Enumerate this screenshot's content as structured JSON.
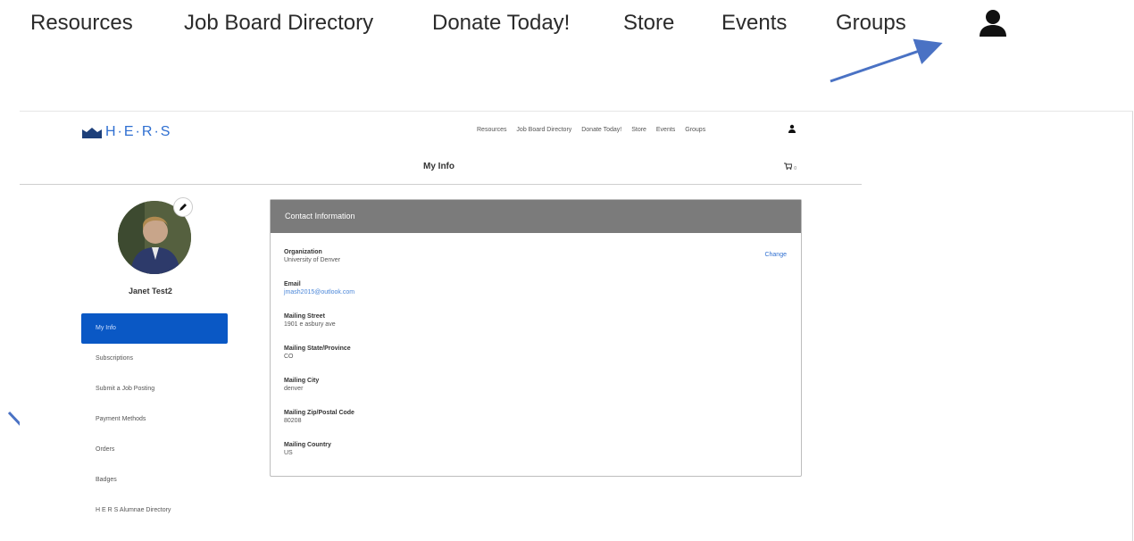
{
  "top_nav": {
    "items": [
      "Resources",
      "Job Board Directory",
      "Donate Today!",
      "Store",
      "Events",
      "Groups"
    ],
    "user_icon": "user-icon"
  },
  "embedded": {
    "logo_text": "H·E·R·S",
    "nav_items": [
      "Resources",
      "Job Board Directory",
      "Donate Today!",
      "Store",
      "Events",
      "Groups"
    ],
    "page_title": "My Info",
    "cart_count": "0",
    "user": {
      "name": "Janet Test2"
    },
    "side_menu": [
      "My Info",
      "Subscriptions",
      "Submit a Job Posting",
      "Payment Methods",
      "Orders",
      "Badges",
      "H E R S Alumnae Directory"
    ],
    "contact": {
      "heading": "Contact Information",
      "change_label": "Change",
      "fields": [
        {
          "label": "Organization",
          "value": "University of Denver"
        },
        {
          "label": "Email",
          "value": "jmash2015@outlook.com"
        },
        {
          "label": "Mailing Street",
          "value": "1901 e asbury ave"
        },
        {
          "label": "Mailing State/Province",
          "value": "CO"
        },
        {
          "label": "Mailing City",
          "value": "denver"
        },
        {
          "label": "Mailing Zip/Postal Code",
          "value": "80208"
        },
        {
          "label": "Mailing Country",
          "value": "US"
        }
      ]
    }
  },
  "colors": {
    "accent": "#0a58c5",
    "arrow": "#4a72c4",
    "header_bar": "#7b7b7b",
    "link": "#2f6fd1"
  }
}
